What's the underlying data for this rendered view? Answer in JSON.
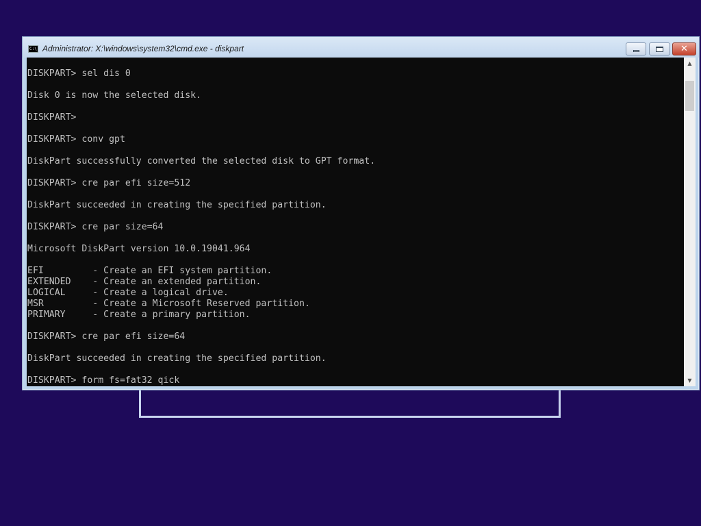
{
  "window": {
    "title": "Administrator: X:\\windows\\system32\\cmd.exe - diskpart",
    "icon_label": "C:\\"
  },
  "controls": {
    "minimize_icon": "minimize-icon",
    "maximize_icon": "maximize-icon",
    "close_glyph": "✕"
  },
  "scrollbar": {
    "up_glyph": "▲",
    "down_glyph": "▼"
  },
  "console": {
    "lines": [
      "DISKPART> sel dis 0",
      "",
      "Disk 0 is now the selected disk.",
      "",
      "DISKPART>",
      "",
      "DISKPART> conv gpt",
      "",
      "DiskPart successfully converted the selected disk to GPT format.",
      "",
      "DISKPART> cre par efi size=512",
      "",
      "DiskPart succeeded in creating the specified partition.",
      "",
      "DISKPART> cre par size=64",
      "",
      "Microsoft DiskPart version 10.0.19041.964",
      "",
      "EFI         - Create an EFI system partition.",
      "EXTENDED    - Create an extended partition.",
      "LOGICAL     - Create a logical drive.",
      "MSR         - Create a Microsoft Reserved partition.",
      "PRIMARY     - Create a primary partition.",
      "",
      "DISKPART> cre par efi size=64",
      "",
      "DiskPart succeeded in creating the specified partition.",
      "",
      "DISKPART> form fs=fat32 qick"
    ]
  },
  "colors": {
    "desktop": "#1e0a5a",
    "console_bg": "#0c0c0c",
    "console_fg": "#c0c0c0"
  }
}
